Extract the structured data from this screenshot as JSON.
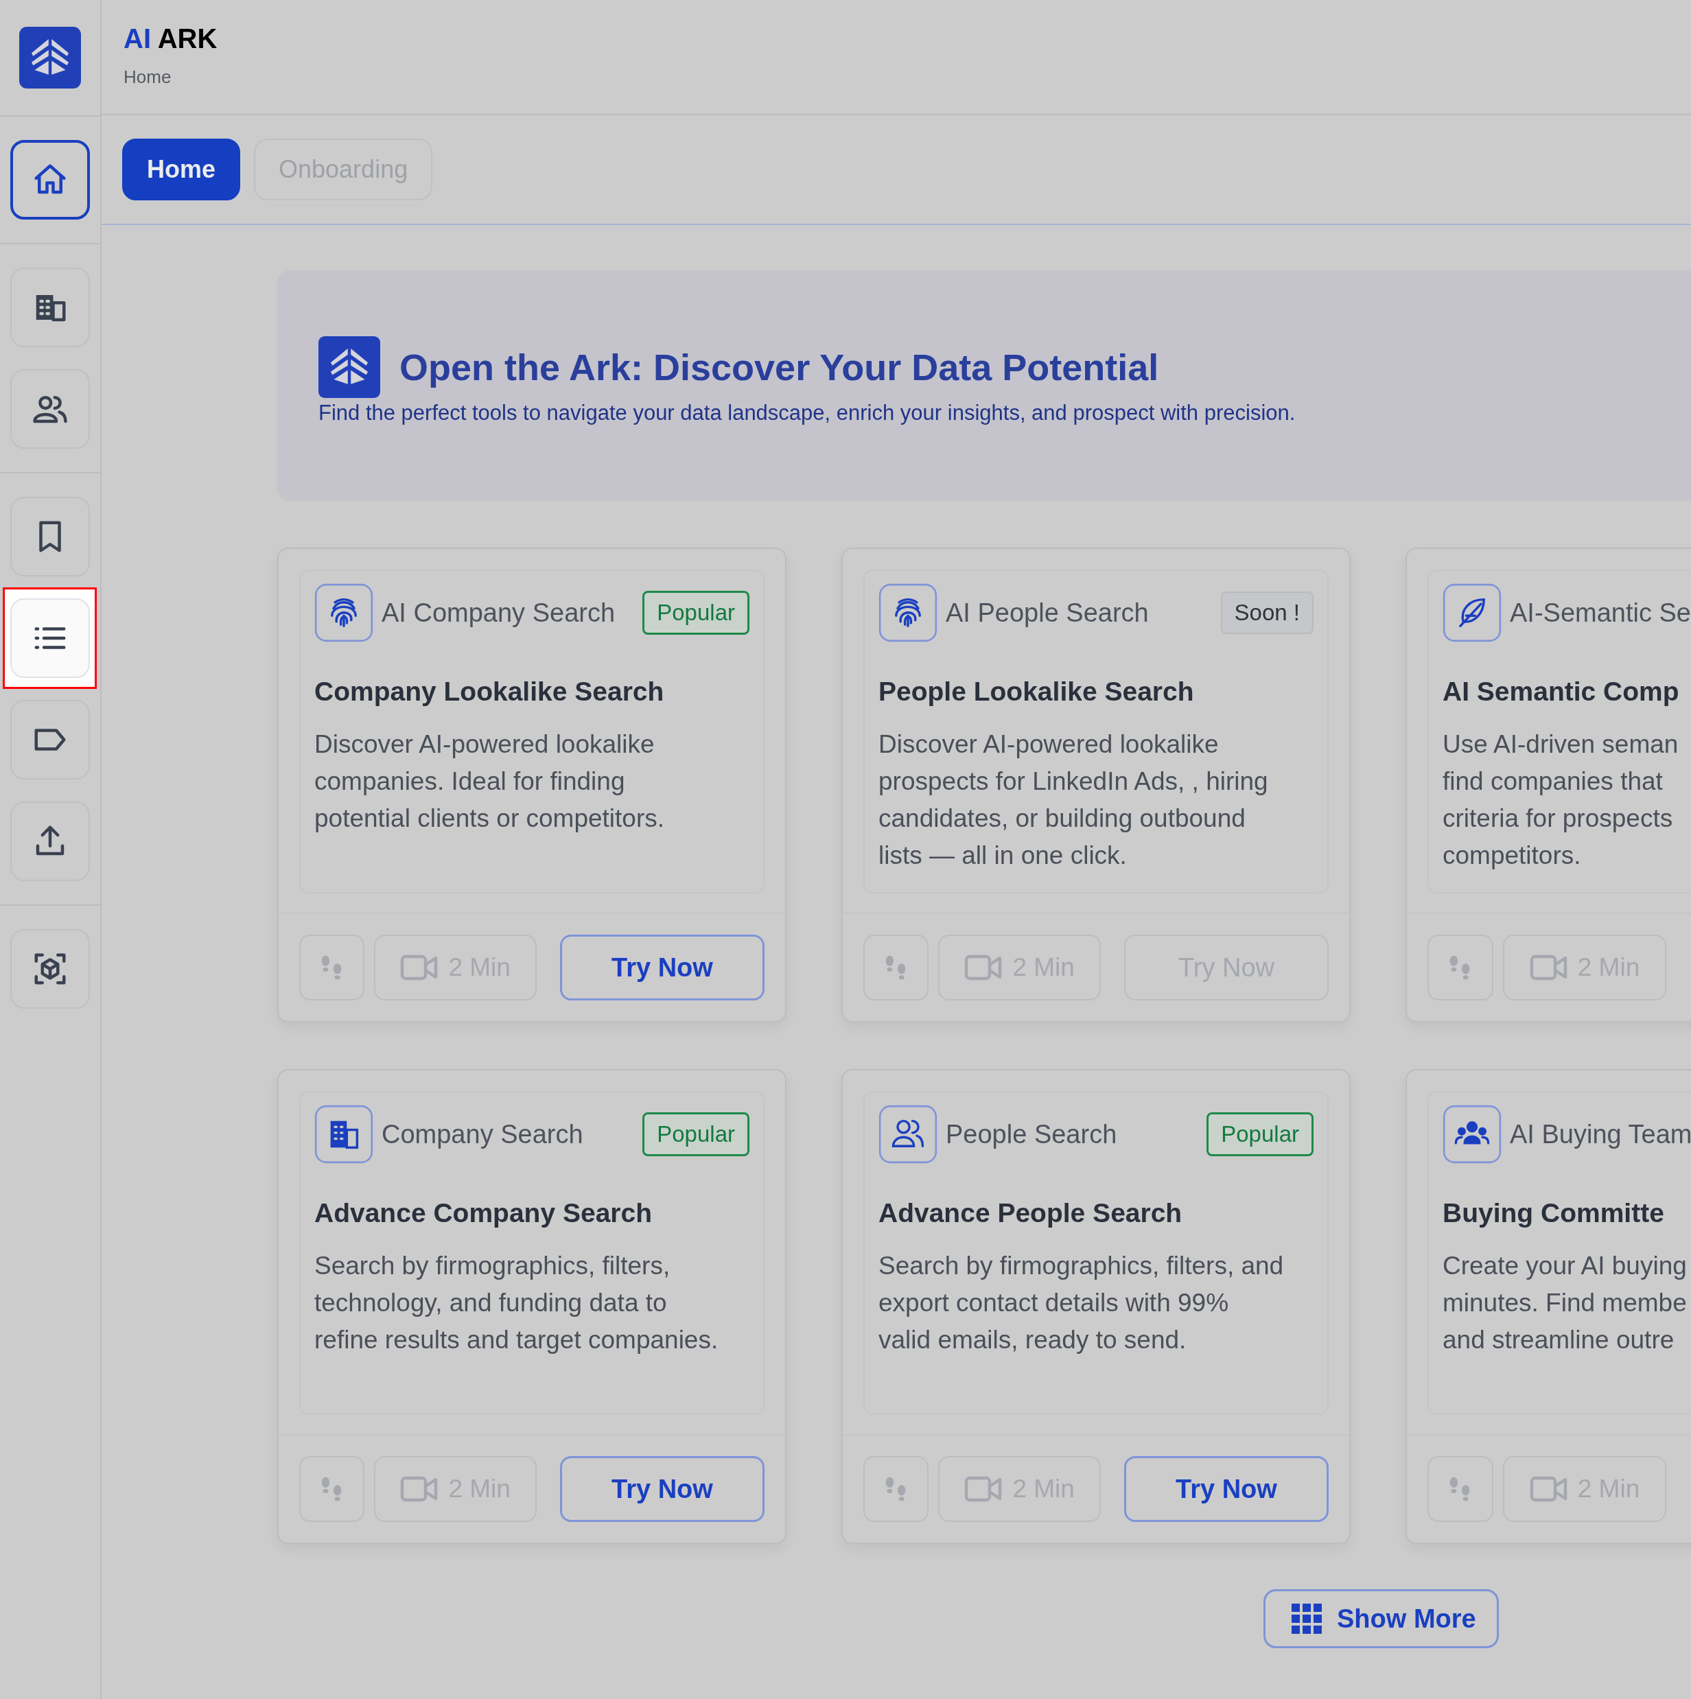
{
  "header": {
    "brand_prefix": "AI",
    "brand_name": "ARK",
    "breadcrumb": "Home"
  },
  "sidebar": {
    "groups": [
      [
        {
          "kind": "home",
          "selected": true,
          "highlighted": false
        }
      ],
      [
        {
          "kind": "building",
          "selected": false,
          "highlighted": false
        },
        {
          "kind": "people",
          "selected": false,
          "highlighted": false
        }
      ],
      [
        {
          "kind": "bookmark",
          "selected": false,
          "highlighted": false
        },
        {
          "kind": "list",
          "selected": false,
          "highlighted": true
        },
        {
          "kind": "tag",
          "selected": false,
          "highlighted": false
        },
        {
          "kind": "upload",
          "selected": false,
          "highlighted": false
        }
      ],
      [
        {
          "kind": "cube",
          "selected": false,
          "highlighted": false
        }
      ]
    ]
  },
  "tabs": [
    {
      "label": "Home",
      "selected": true
    },
    {
      "label": "Onboarding",
      "selected": false
    }
  ],
  "banner": {
    "title": "Open the Ark: Discover Your Data Potential",
    "subtitle": "Find the perfect tools to navigate your data landscape, enrich your insights, and prospect with precision."
  },
  "cards": [
    {
      "kind": "fingerprint",
      "category": "AI Company Search",
      "badge": {
        "kind": "popular",
        "label": "Popular"
      },
      "title": "Company Lookalike Search",
      "description_lines": [
        "Discover AI-powered lookalike",
        "companies. Ideal for finding",
        "potential clients or competitors."
      ],
      "duration": "2 Min",
      "try_button": {
        "label": "Try Now",
        "disabled": false
      }
    },
    {
      "kind": "fingerprint",
      "category": "AI People Search",
      "badge": {
        "kind": "soon",
        "label": "Soon !"
      },
      "title": "People Lookalike Search",
      "description_lines": [
        "Discover AI-powered lookalike",
        "prospects for LinkedIn Ads, , hiring",
        "candidates, or building outbound",
        "lists — all in one click."
      ],
      "duration": "2 Min",
      "try_button": {
        "label": "Try Now",
        "disabled": true
      }
    },
    {
      "kind": "feather",
      "category": "AI-Semantic Se",
      "title": "AI Semantic Comp",
      "description_lines": [
        "Use AI-driven seman",
        "find companies that",
        "criteria for prospects",
        "competitors."
      ],
      "duration": "2 Min"
    },
    {
      "kind": "building",
      "category": "Company Search",
      "badge": {
        "kind": "popular",
        "label": "Popular"
      },
      "title": "Advance Company Search",
      "description_lines": [
        "Search by firmographics, filters,",
        "technology, and funding data to",
        "refine results and target companies."
      ],
      "duration": "2 Min",
      "try_button": {
        "label": "Try Now",
        "disabled": false
      }
    },
    {
      "kind": "people",
      "category": "People Search",
      "badge": {
        "kind": "popular",
        "label": "Popular"
      },
      "title": "Advance People Search",
      "description_lines": [
        "Search by firmographics, filters, and",
        "export contact details with 99%",
        "valid emails, ready to send."
      ],
      "duration": "2 Min",
      "try_button": {
        "label": "Try Now",
        "disabled": false
      }
    },
    {
      "kind": "group",
      "category": "AI Buying Team",
      "title": "Buying Committe",
      "description_lines": [
        "Create your AI buying",
        "minutes. Find membe",
        "and streamline outre"
      ],
      "duration": "2 Min"
    }
  ],
  "show_more": {
    "label": "Show More"
  }
}
